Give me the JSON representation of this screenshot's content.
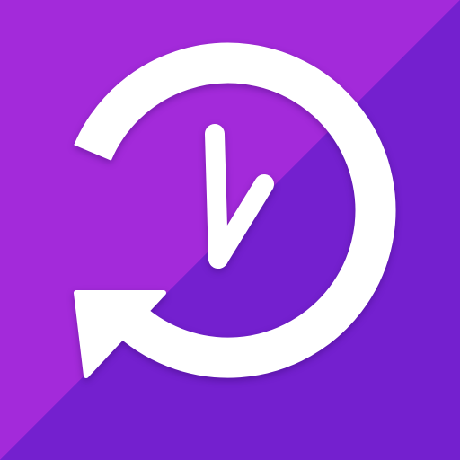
{
  "icon": {
    "name": "history-clock-icon",
    "background_light": "#a32ada",
    "background_dark": "#7420cf",
    "glyph_color": "#ffffff"
  }
}
